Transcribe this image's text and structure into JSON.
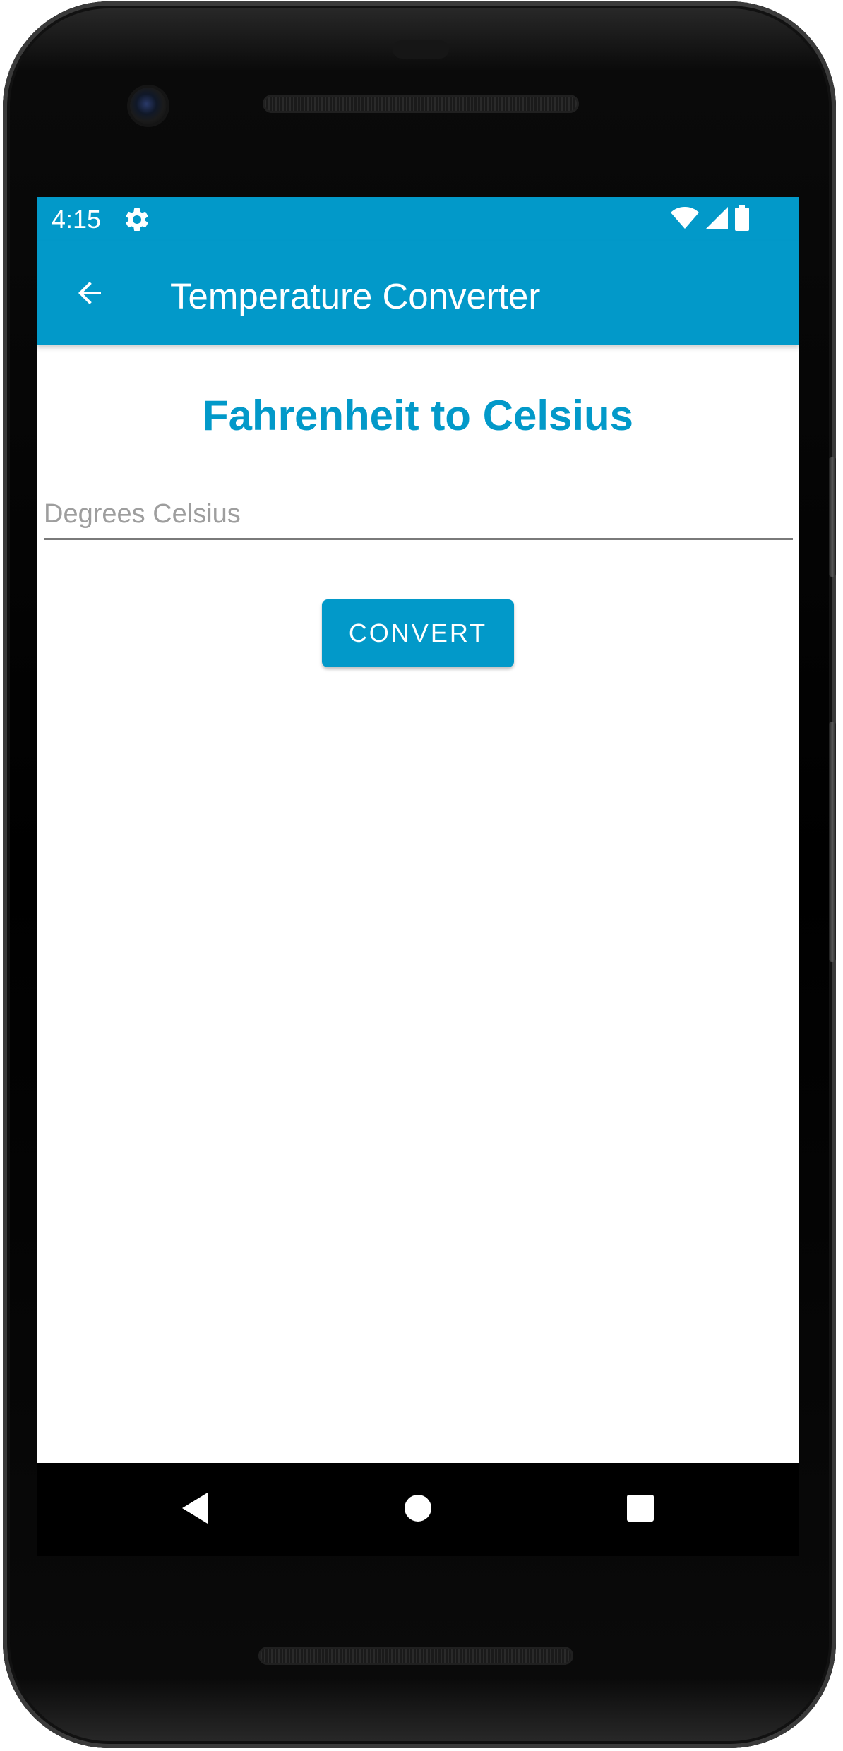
{
  "status_bar": {
    "time": "4:15",
    "icons": [
      "settings-gear-icon",
      "wifi-icon",
      "cellular-signal-icon",
      "battery-icon"
    ]
  },
  "app_bar": {
    "title": "Temperature Converter",
    "back_icon": "arrow-back-icon"
  },
  "main": {
    "heading": "Fahrenheit to Celsius",
    "input": {
      "value": "",
      "placeholder": "Degrees Celsius"
    },
    "convert_label": "CONVERT"
  },
  "navigation_bar": {
    "icons": [
      "nav-back-icon",
      "nav-home-icon",
      "nav-recents-icon"
    ]
  },
  "colors": {
    "accent": "#0299c9",
    "background": "#ffffff",
    "placeholder": "#9e9e9e",
    "input_underline": "#7a7a7a",
    "frame": "#000000"
  }
}
